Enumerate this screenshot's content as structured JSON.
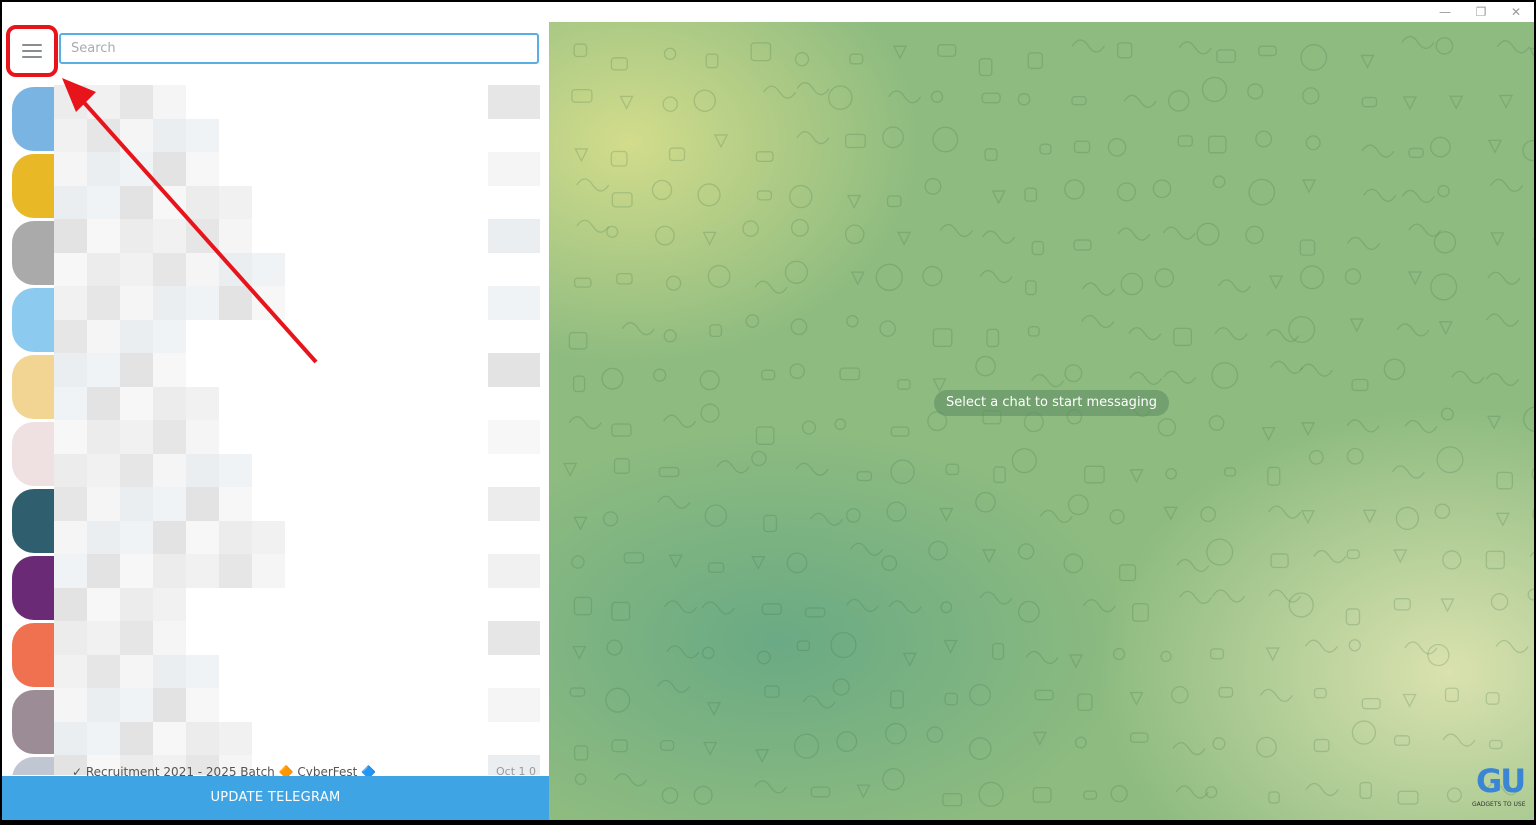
{
  "window": {
    "minimize_glyph": "—",
    "restore_glyph": "❐",
    "close_glyph": "✕"
  },
  "sidebar": {
    "menu_icon": "hamburger-menu-icon",
    "search": {
      "placeholder": "Search",
      "value": ""
    },
    "chats": [
      {
        "avatar_color": "#7ab4e2"
      },
      {
        "avatar_color": "#e8b826"
      },
      {
        "avatar_color": "#aaaaaa"
      },
      {
        "avatar_color": "#8ccaf0"
      },
      {
        "avatar_color": "#f2d592"
      },
      {
        "avatar_color": "#efe0e2"
      },
      {
        "avatar_color": "#2f5f6e"
      },
      {
        "avatar_color": "#6a2a76"
      },
      {
        "avatar_color": "#f07150"
      },
      {
        "avatar_color": "#9b8c95"
      },
      {
        "avatar_color": "#c0c6d2"
      }
    ],
    "partial_chat": {
      "text": "✓ Recruitment 2021 - 2025 Batch 🔶 CyberFest 🔷",
      "time": "Oct 1 0"
    },
    "update_button": "UPDATE TELEGRAM"
  },
  "chat_area": {
    "empty_state": "Select a chat to start messaging"
  },
  "watermark": {
    "logo": "GU",
    "tagline": "GADGETS TO USE"
  },
  "colors": {
    "accent": "#3fa4e3",
    "highlight": "#e8141b",
    "search_border": "#5aaee3"
  }
}
